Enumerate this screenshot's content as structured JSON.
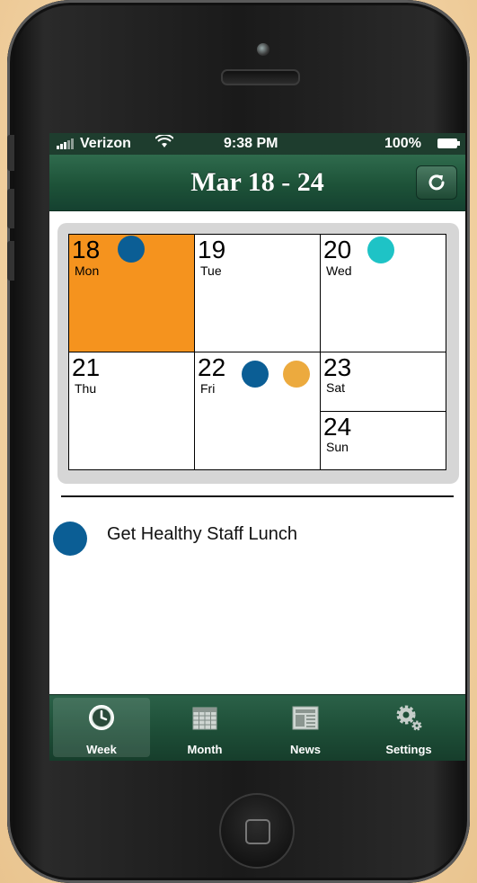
{
  "status_bar": {
    "carrier": "Verizon",
    "time": "9:38 PM",
    "battery": "100%"
  },
  "header": {
    "title": "Mar 18 - 24",
    "refresh_icon": "refresh-icon"
  },
  "week": {
    "days": [
      {
        "num": "18",
        "name": "Mon",
        "highlighted": true,
        "dots": [
          "#0b5e95"
        ]
      },
      {
        "num": "19",
        "name": "Tue",
        "highlighted": false,
        "dots": []
      },
      {
        "num": "20",
        "name": "Wed",
        "highlighted": false,
        "dots": [
          "#1ec3c6"
        ]
      },
      {
        "num": "21",
        "name": "Thu",
        "highlighted": false,
        "dots": []
      },
      {
        "num": "22",
        "name": "Fri",
        "highlighted": false,
        "dots": [
          "#0b5e95",
          "#ecaa3e"
        ]
      },
      {
        "num": "23",
        "name": "Sat",
        "highlighted": false,
        "dots": []
      },
      {
        "num": "24",
        "name": "Sun",
        "highlighted": false,
        "dots": []
      }
    ],
    "highlight_color": "#f5931e"
  },
  "events": [
    {
      "title": "Get Healthy Staff Lunch",
      "color": "#0b5e95"
    }
  ],
  "tabs": [
    {
      "label": "Week",
      "icon": "clock-icon",
      "active": true
    },
    {
      "label": "Month",
      "icon": "calendar-icon",
      "active": false
    },
    {
      "label": "News",
      "icon": "newspaper-icon",
      "active": false
    },
    {
      "label": "Settings",
      "icon": "gears-icon",
      "active": false
    }
  ],
  "colors": {
    "bar_green": "#1d5238",
    "event_blue": "#0b5e95"
  }
}
